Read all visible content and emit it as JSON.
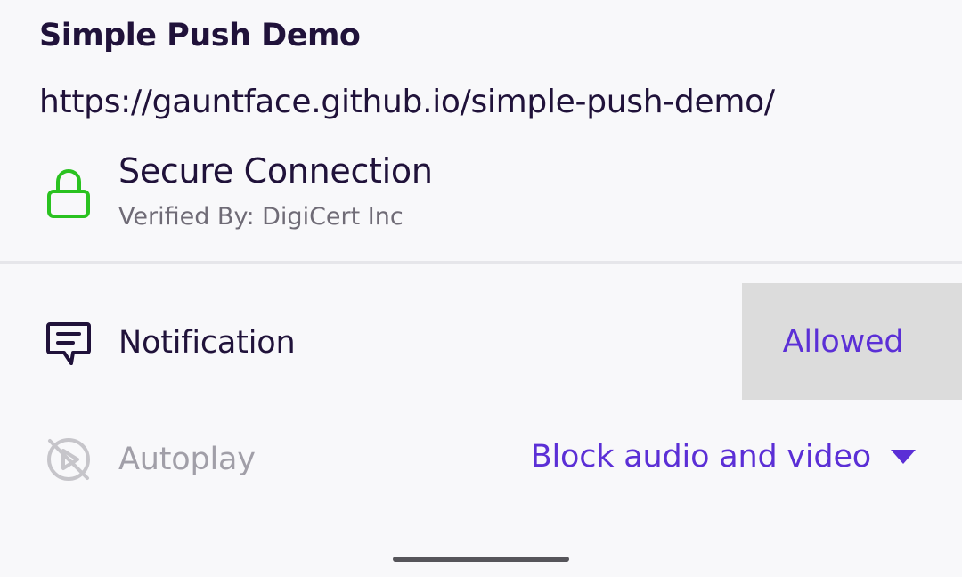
{
  "site": {
    "title": "Simple Push Demo",
    "url": "https://gauntface.github.io/simple-push-demo/"
  },
  "security": {
    "title": "Secure Connection",
    "verified_by": "Verified By: DigiCert Inc",
    "icon": "lock-icon",
    "color": "#2ac220"
  },
  "permissions": {
    "notification": {
      "label": "Notification",
      "value": "Allowed",
      "icon": "notification-icon"
    },
    "autoplay": {
      "label": "Autoplay",
      "value": "Block audio and video",
      "icon": "autoplay-blocked-icon",
      "disabled": true
    }
  },
  "colors": {
    "accent": "#5b2fd6",
    "text_primary": "#20123a",
    "text_secondary": "#6f6b76",
    "text_disabled": "#a19fa8",
    "highlight": "#dcdcdc"
  }
}
